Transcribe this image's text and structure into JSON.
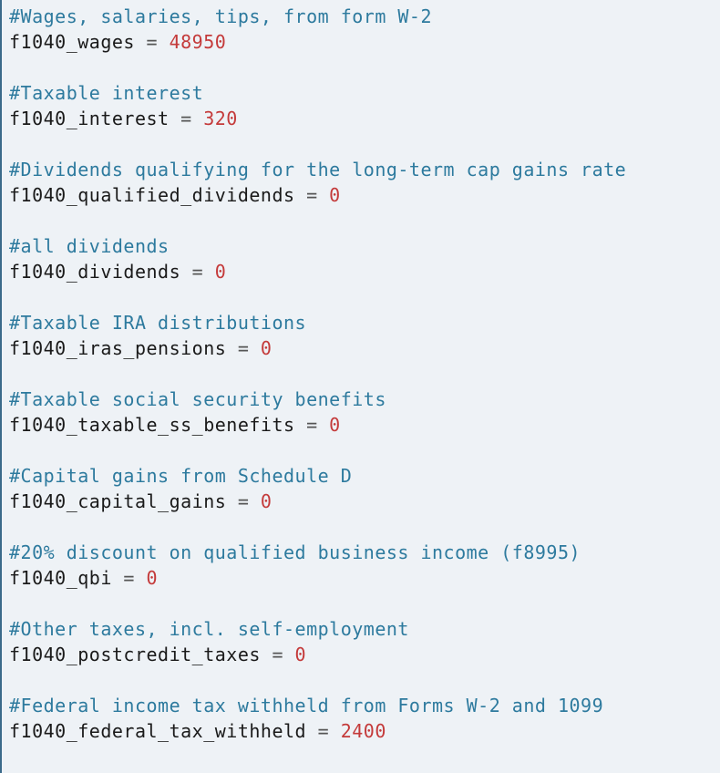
{
  "blocks": [
    {
      "comment": "#Wages, salaries, tips, from form W-2",
      "ident": "f1040_wages",
      "op": " = ",
      "value": "48950"
    },
    {
      "comment": "#Taxable interest",
      "ident": "f1040_interest",
      "op": " = ",
      "value": "320"
    },
    {
      "comment": "#Dividends qualifying for the long-term cap gains rate",
      "ident": "f1040_qualified_dividends",
      "op": " = ",
      "value": "0"
    },
    {
      "comment": "#all dividends",
      "ident": "f1040_dividends",
      "op": " = ",
      "value": "0"
    },
    {
      "comment": "#Taxable IRA distributions",
      "ident": "f1040_iras_pensions",
      "op": " = ",
      "value": "0"
    },
    {
      "comment": "#Taxable social security benefits",
      "ident": "f1040_taxable_ss_benefits",
      "op": " = ",
      "value": "0"
    },
    {
      "comment": "#Capital gains from Schedule D",
      "ident": "f1040_capital_gains",
      "op": " = ",
      "value": "0"
    },
    {
      "comment": "#20% discount on qualified business income (f8995)",
      "ident": "f1040_qbi",
      "op": " = ",
      "value": "0"
    },
    {
      "comment": "#Other taxes, incl. self-employment",
      "ident": "f1040_postcredit_taxes",
      "op": " = ",
      "value": "0"
    },
    {
      "comment": "#Federal income tax withheld from Forms W-2 and 1099",
      "ident": "f1040_federal_tax_withheld",
      "op": " = ",
      "value": "2400"
    }
  ]
}
